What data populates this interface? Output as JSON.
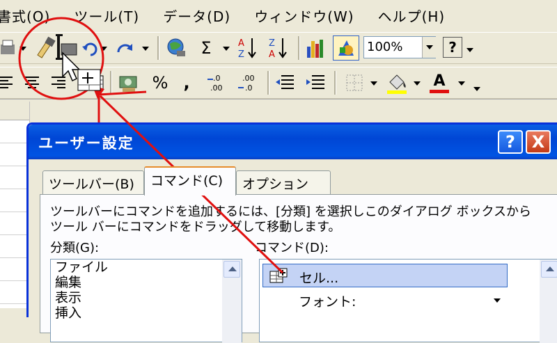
{
  "menubar": {
    "items": [
      "書式(O)",
      "ツール(T)",
      "データ(D)",
      "ウィンドウ(W)",
      "ヘルプ(H)"
    ]
  },
  "toolbar": {
    "zoom_value": "100%",
    "percent_label": "%",
    "comma_label": ",",
    "sigma_label": "Σ",
    "font_color_letter": "A"
  },
  "dialog": {
    "title": "ユーザー設定",
    "help_label": "?",
    "close_label": "X",
    "tabs": [
      "ツールバー(B)",
      "コマンド(C)",
      "オプション(O)"
    ],
    "active_tab": 1,
    "description_line1": "ツールバーにコマンドを追加するには、[分類] を選択しこのダイアログ ボックスから",
    "description_line2": "ツール バーにコマンドをドラッグして移動します。",
    "categories_label": "分類(G):",
    "commands_label": "コマンド(D):",
    "categories": [
      "ファイル",
      "編集",
      "表示",
      "挿入"
    ],
    "commands": [
      "セル...",
      "フォント:"
    ]
  },
  "colors": {
    "title_blue": "#0054e3",
    "annotation_red": "#e01010",
    "highlight": "#c4d3f5"
  }
}
